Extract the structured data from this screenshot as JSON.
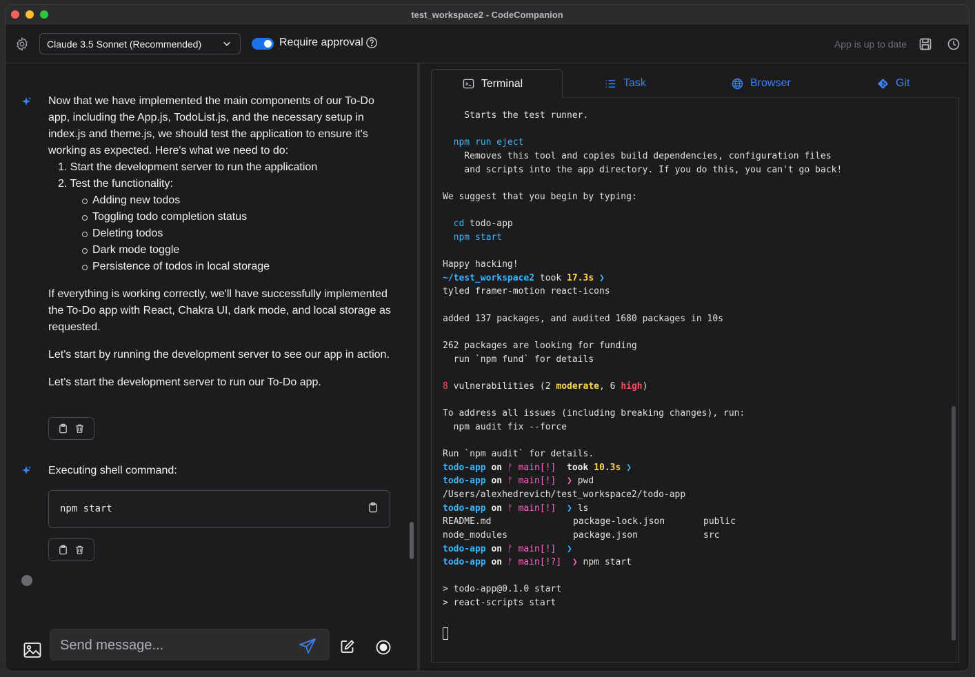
{
  "window": {
    "title": "test_workspace2 - CodeCompanion"
  },
  "toolbar": {
    "model": "Claude 3.5 Sonnet (Recommended)",
    "approval_label": "Require approval",
    "status": "App is up to date"
  },
  "chat": {
    "msg1": {
      "intro": "Now that we have implemented the main components of our To-Do app, including the App.js, TodoList.js, and the necessary setup in index.js and theme.js, we should test the application to ensure it's working as expected. Here's what we need to do:",
      "step1": "1. Start the development server to run the application",
      "step2": "2. Test the functionality:",
      "sub": [
        "Adding new todos",
        "Toggling todo completion status",
        "Deleting todos",
        "Dark mode toggle",
        "Persistence of todos in local storage"
      ],
      "p2": "If everything is working correctly, we'll have successfully implemented the To-Do app with React, Chakra UI, dark mode, and local storage as requested.",
      "p3": "Let's start by running the development server to see our app in action.",
      "p4": "Let's start the development server to run our To-Do app."
    },
    "msg2": {
      "label": "Executing shell command:",
      "command": "npm start"
    },
    "input_placeholder": "Send message..."
  },
  "tabs": {
    "terminal": "Terminal",
    "task": "Task",
    "browser": "Browser",
    "git": "Git"
  },
  "terminal": {
    "l01": "    Starts the test runner.",
    "l03a": "  ",
    "l03b": "npm run eject",
    "l04": "    Removes this tool and copies build dependencies, configuration files",
    "l05": "    and scripts into the app directory. If you do this, you can't go back!",
    "l07": "We suggest that you begin by typing:",
    "l09a": "  ",
    "l09b": "cd",
    "l09c": " todo-app",
    "l10a": "  ",
    "l10b": "npm start",
    "l12": "Happy hacking!",
    "l13a": "~/test_workspace2",
    "l13b": " took ",
    "l13c": "17.3s",
    "l13d": " ❯",
    "l14": "tyled framer-motion react-icons",
    "l16": "added 137 packages, and audited 1680 packages in 10s",
    "l18": "262 packages are looking for funding",
    "l19": "  run `npm fund` for details",
    "l21a": "8",
    "l21b": " vulnerabilities (2 ",
    "l21c": "moderate",
    "l21d": ", 6 ",
    "l21e": "high",
    "l21f": ")",
    "l23": "To address all issues (including breaking changes), run:",
    "l24": "  npm audit fix --force",
    "l26": "Run `npm audit` for details.",
    "p_dir": "todo-app",
    "p_on": " on ",
    "p_branch_icon": "ᚠ",
    "p_main_bang": "main[!]",
    "p_main_bangq": "main[!?]",
    "p_arrow": "❯",
    "p_took": "took ",
    "p_time": "10.3s",
    "cmd_pwd": "pwd",
    "out_pwd": "/Users/alexhedrevich/test_workspace2/todo-app",
    "cmd_ls": "ls",
    "ls_row1": [
      "README.md",
      "package-lock.json",
      "public"
    ],
    "ls_row2": [
      "node_modules",
      "package.json",
      "src"
    ],
    "cmd_npm": "npm start",
    "out1": "> todo-app@0.1.0 start",
    "out2": "> react-scripts start"
  }
}
